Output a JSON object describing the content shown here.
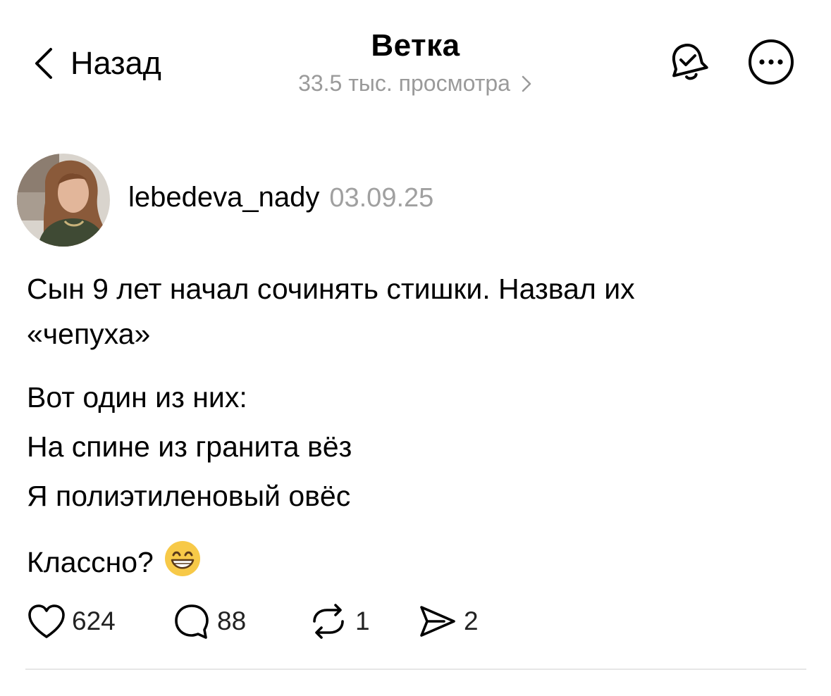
{
  "header": {
    "back_label": "Назад",
    "title": "Ветка",
    "views": "33.5 тыс. просмотра",
    "icons": [
      "chevron-left-icon",
      "bell-check-icon",
      "more-icon",
      "chevron-right-icon"
    ]
  },
  "post": {
    "username": "lebedeva_nady",
    "date": "03.09.25",
    "lines": [
      "Сын 9 лет начал сочинять стишки. Назвал их",
      "«чепуха»",
      "Вот один из них:",
      "На спине из гранита вёз",
      "Я полиэтиленовый овёс",
      "Классно?"
    ],
    "emoji": "grinning-face-emoji",
    "actions": {
      "likes": "624",
      "comments": "88",
      "reposts": "1",
      "shares": "2"
    }
  },
  "colors": {
    "muted": "#9a9a9a",
    "divider": "#e6e6e6"
  }
}
